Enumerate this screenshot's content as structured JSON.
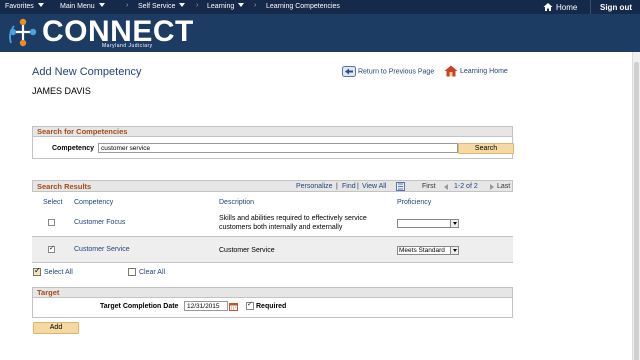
{
  "topnav": {
    "favorites": "Favorites",
    "main_menu": "Main Menu",
    "self_service": "Self Service",
    "learning": "Learning",
    "learning_competencies": "Learning Competencies",
    "home": "Home",
    "sign_out": "Sign out",
    "separator": "›"
  },
  "banner": {
    "brand": "CONNECT",
    "subtitle": "Maryland Judiciary"
  },
  "page": {
    "title": "Add New Competency",
    "return_link": "Return to Previous Page",
    "learning_home_link": "Learning Home",
    "person_name": "JAMES DAVIS"
  },
  "search": {
    "section_title": "Search for Competencies",
    "label": "Competency",
    "value": "customer service",
    "button": "Search"
  },
  "results": {
    "section_title": "Search Results",
    "personalize": "Personalize",
    "divider": "|",
    "find": "Find",
    "view_all": "View All",
    "first": "First",
    "range": "1-2 of 2",
    "last": "Last",
    "columns": [
      "Select",
      "Competency",
      "Description",
      "Proficiency"
    ],
    "rows": [
      {
        "selected": false,
        "competency": "Customer Focus",
        "description_line1": "Skills and abilities required to effectively service",
        "description_line2": "customers both internally and externally",
        "proficiency": ""
      },
      {
        "selected": true,
        "competency": "Customer Service",
        "description_line1": "Customer Service",
        "description_line2": "",
        "proficiency": "Meets Standard"
      }
    ],
    "select_all": "Select All",
    "clear_all": "Clear All"
  },
  "target": {
    "section_title": "Target",
    "date_label": "Target Completion Date",
    "date_value": "12/31/2015",
    "required_label": "Required",
    "required_checked": true
  },
  "actions": {
    "add_button": "Add"
  },
  "colors": {
    "topbar": "#15294a",
    "banner": "#1d3c64",
    "link": "#21447a",
    "section_title": "#a04c1c",
    "button": "#f6d8a2"
  }
}
